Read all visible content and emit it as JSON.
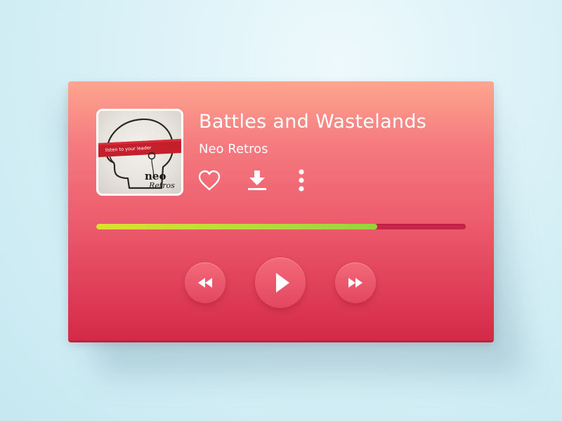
{
  "track": {
    "title": "Battles and Wastelands",
    "artist": "Neo Retros"
  },
  "album_art": {
    "banner_text": "listen to your leader",
    "logo_top": "neo",
    "logo_bottom": "Retros"
  },
  "actions": [
    {
      "name": "like",
      "icon": "heart-icon"
    },
    {
      "name": "download",
      "icon": "download-icon"
    },
    {
      "name": "more",
      "icon": "more-vertical-icon"
    }
  ],
  "playback": {
    "progress_fraction": 0.76
  },
  "controls": [
    {
      "name": "rewind",
      "icon": "rewind-icon"
    },
    {
      "name": "play",
      "icon": "play-icon"
    },
    {
      "name": "fast-forward",
      "icon": "fast-forward-icon"
    }
  ],
  "colors": {
    "card_top": "#fea58f",
    "card_bottom": "#d32a48",
    "progress_track": "#c8254a",
    "progress_fill_start": "#dde030",
    "progress_fill_end": "#97d33f",
    "icon": "#ffffff"
  }
}
